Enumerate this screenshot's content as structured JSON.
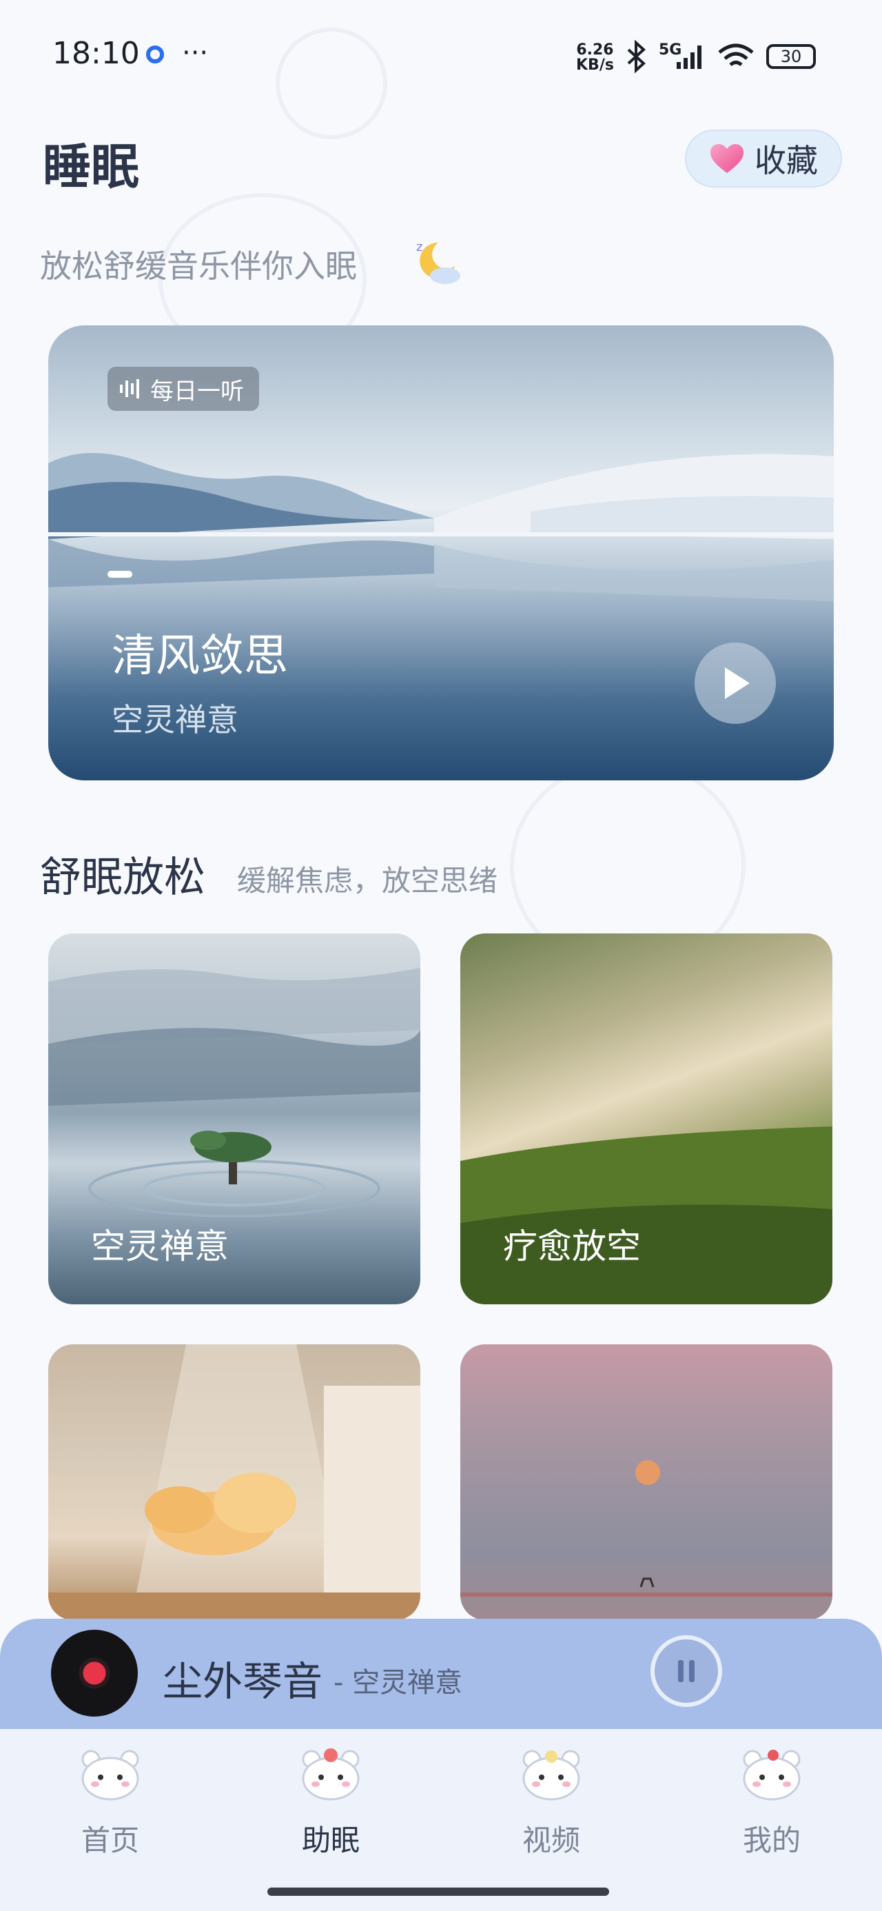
{
  "status_bar": {
    "time": "18:10",
    "network_speed": "6.26",
    "network_speed_unit": "KB/s",
    "signal_type": "5G",
    "battery": "30"
  },
  "header": {
    "title": "睡眠",
    "favorite_label": "收藏",
    "subtitle": "放松舒缓音乐伴你入眠"
  },
  "featured": {
    "badge": "每日一听",
    "title": "清风敛思",
    "subtitle": "空灵禅意"
  },
  "section": {
    "title": "舒眠放松",
    "subtitle": "缓解焦虑，放空思绪"
  },
  "categories": [
    {
      "label": "空灵禅意"
    },
    {
      "label": "疗愈放空"
    },
    {
      "label": ""
    },
    {
      "label": ""
    }
  ],
  "now_playing": {
    "title": "尘外琴音",
    "artist": "- 空灵禅意"
  },
  "tabs": [
    {
      "label": "首页",
      "active": false
    },
    {
      "label": "助眠",
      "active": true
    },
    {
      "label": "视频",
      "active": false
    },
    {
      "label": "我的",
      "active": false
    }
  ],
  "colors": {
    "accent": "#a6bde9",
    "title_text": "#2b3448",
    "muted_text": "#8e96a4"
  }
}
